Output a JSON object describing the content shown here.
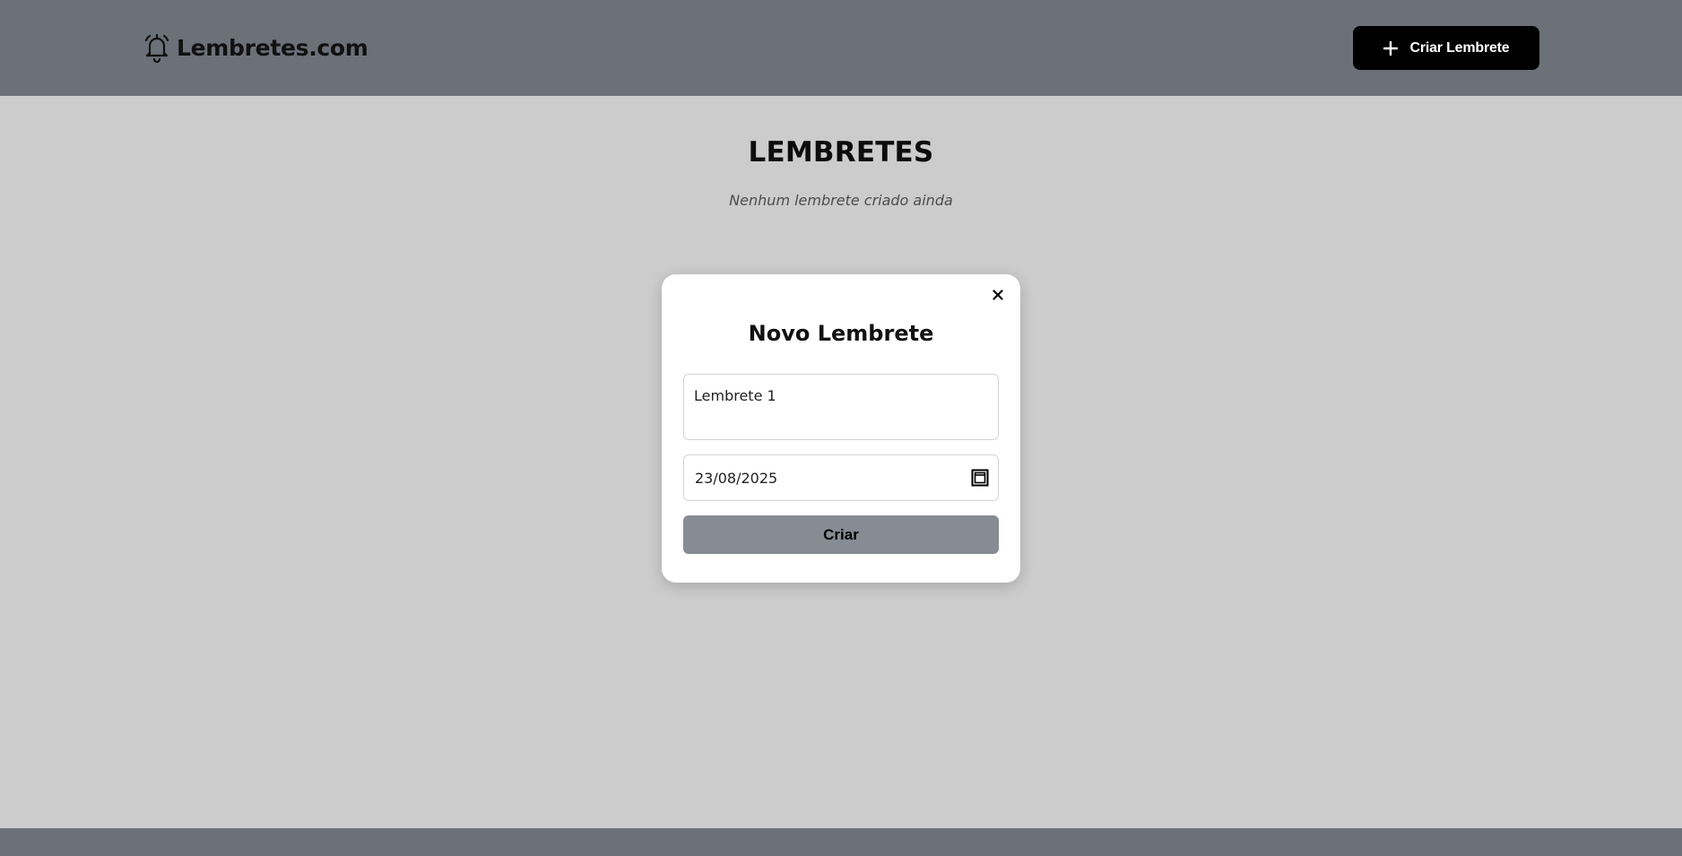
{
  "header": {
    "logo_icon": "bell-icon",
    "logo_text": "Lembretes.com",
    "create_button": {
      "icon": "plus-icon",
      "label": "Criar Lembrete"
    }
  },
  "main": {
    "title": "LEMBRETES",
    "empty_message": "Nenhum lembrete criado ainda"
  },
  "modal": {
    "close_icon": "close-icon",
    "title": "Novo Lembrete",
    "text_field_value": "Lembrete 1",
    "date_field_value": "23/08/2025",
    "calendar_icon": "calendar-icon",
    "submit_label": "Criar"
  },
  "colors": {
    "header_bg": "#6b7079",
    "page_bg": "#cccccc",
    "primary_button_bg": "#000000",
    "submit_button_bg": "#868b94",
    "modal_bg": "#ffffff"
  }
}
